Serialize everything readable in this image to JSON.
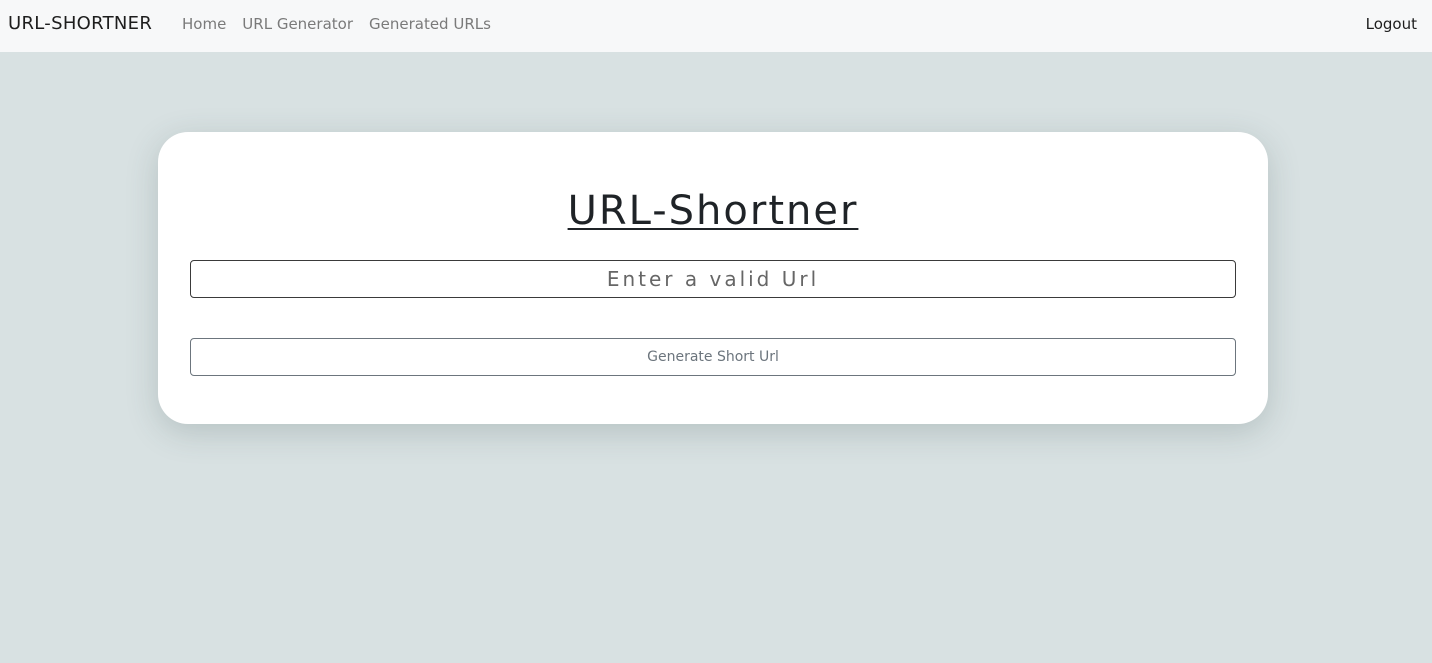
{
  "navbar": {
    "brand": "URL-SHORTNER",
    "links": [
      "Home",
      "URL Generator",
      "Generated URLs"
    ],
    "logout": "Logout"
  },
  "card": {
    "title": "URL-Shortner",
    "input_placeholder": "Enter a valid Url",
    "input_value": "",
    "button_label": "Generate Short Url"
  },
  "colors": {
    "page_background": "#d8e1e2",
    "navbar_background": "#f7f8f9",
    "card_background": "#ffffff"
  }
}
